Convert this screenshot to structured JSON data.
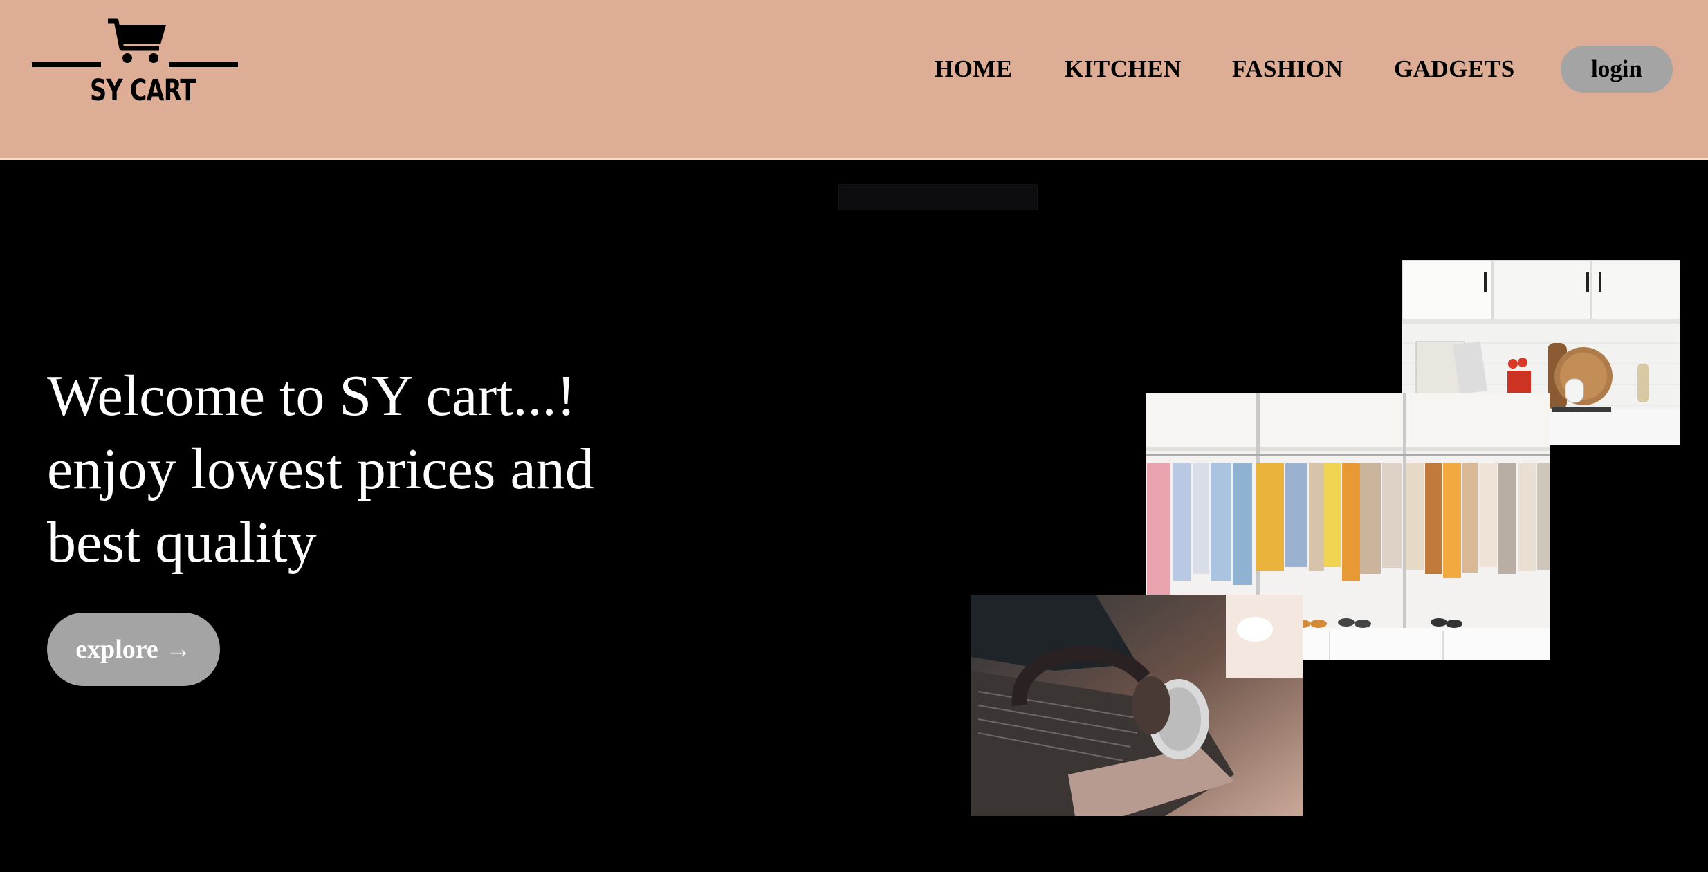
{
  "brand": {
    "name": "SY CART",
    "icon": "shopping-cart-icon"
  },
  "nav": {
    "items": [
      "HOME",
      "KITCHEN",
      "FASHION",
      "GADGETS"
    ],
    "login_label": "login"
  },
  "hero": {
    "line1": "Welcome to SY cart...!",
    "line2": "enjoy lowest prices and",
    "line3": "best quality",
    "explore_label": "explore",
    "explore_arrow": "→"
  },
  "photos": {
    "kitchen": "kitchen-photo",
    "fashion": "clothing-rack-photo",
    "gadgets": "laptop-headphones-photo"
  },
  "colors": {
    "header_bg": "#ddad95",
    "page_bg": "#000000",
    "button_bg": "#a4a4a4"
  }
}
